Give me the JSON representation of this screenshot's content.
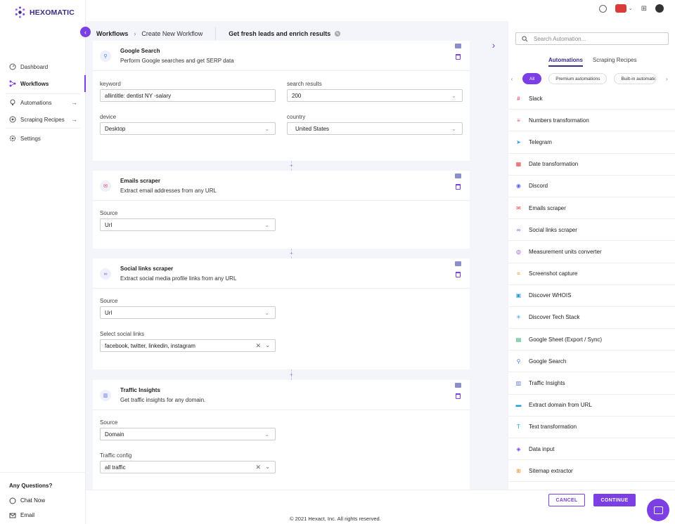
{
  "app": {
    "name": "HEXOMATIC"
  },
  "sidebar": {
    "items": [
      {
        "label": "Dashboard",
        "icon": "dashboard-icon"
      },
      {
        "label": "Workflows",
        "icon": "workflow-icon",
        "active": true
      },
      {
        "label": "Automations",
        "icon": "automation-icon",
        "arrow": "→"
      },
      {
        "label": "Scraping Recipes",
        "icon": "recipe-icon",
        "arrow": "→"
      },
      {
        "label": "Settings",
        "icon": "gear-icon"
      }
    ],
    "questions_title": "Any Questions?",
    "chat_label": "Chat Now",
    "email_label": "Email"
  },
  "breadcrumb": {
    "root": "Workflows",
    "current": "Create New Workflow"
  },
  "workflow_title": "Get fresh leads and enrich results",
  "cards": [
    {
      "title": "Google Search",
      "description": "Perform Google searches and get SERP data",
      "fields": [
        {
          "label": "keyword",
          "value": "allintitle: dentist NY -salary"
        },
        {
          "label": "search results",
          "value": "200"
        },
        {
          "label": "device",
          "value": "Desktop"
        },
        {
          "label": "country",
          "value": "United States"
        }
      ]
    },
    {
      "title": "Emails scraper",
      "description": "Extract email addresses from any URL",
      "fields": [
        {
          "label": "Source",
          "value": "Url"
        }
      ]
    },
    {
      "title": "Social links scraper",
      "description": "Extract social media profile links from any URL",
      "fields": [
        {
          "label": "Source",
          "value": "Url"
        },
        {
          "label": "Select social links",
          "value": "facebook, twitter, linkedin, instagram"
        }
      ]
    },
    {
      "title": "Traffic Insights",
      "description": "Get traffic insights for any domain.",
      "fields": [
        {
          "label": "Source",
          "value": "Domain"
        },
        {
          "label": "Traffic config",
          "value": "all traffic"
        }
      ]
    }
  ],
  "right_panel": {
    "search_placeholder": "Search Automation...",
    "tabs": [
      "Automations",
      "Scraping Recipes"
    ],
    "chips": [
      "All",
      "Premium automations",
      "Built-in automations"
    ],
    "automations": [
      {
        "label": "Slack",
        "color": "#e01e5a",
        "glyph": "#"
      },
      {
        "label": "Numbers transformation",
        "color": "#d94b6b",
        "glyph": "≡"
      },
      {
        "label": "Telegram",
        "color": "#2a9fd9",
        "glyph": "➤"
      },
      {
        "label": "Date transformation",
        "color": "#e0403f",
        "glyph": "▦"
      },
      {
        "label": "Discord",
        "color": "#5865f2",
        "glyph": "◉"
      },
      {
        "label": "Emails scraper",
        "color": "#e0403f",
        "glyph": "✉"
      },
      {
        "label": "Social links scraper",
        "color": "#5a6fd8",
        "glyph": "∞"
      },
      {
        "label": "Measurement units converter",
        "color": "#7b3fe4",
        "glyph": "◎"
      },
      {
        "label": "Screenshot capture",
        "color": "#f08a24",
        "glyph": "⌗"
      },
      {
        "label": "Discover WHOIS",
        "color": "#2a9fd9",
        "glyph": "▣"
      },
      {
        "label": "Discover Tech Stack",
        "color": "#2a9fd9",
        "glyph": "✳"
      },
      {
        "label": "Google Sheet (Export / Sync)",
        "color": "#1fa463",
        "glyph": "▤"
      },
      {
        "label": "Google Search",
        "color": "#4285f4",
        "glyph": "⚲"
      },
      {
        "label": "Traffic Insights",
        "color": "#5a6fd8",
        "glyph": "▥"
      },
      {
        "label": "Extract domain from URL",
        "color": "#1aa1d9",
        "glyph": "▬"
      },
      {
        "label": "Text transformation",
        "color": "#2a9fd9",
        "glyph": "T"
      },
      {
        "label": "Data input",
        "color": "#7b3fe4",
        "glyph": "◈"
      },
      {
        "label": "Sitemap extractor",
        "color": "#f08a24",
        "glyph": "⊞"
      }
    ]
  },
  "footer": {
    "cancel_label": "CANCEL",
    "continue_label": "CONTINUE",
    "copyright": "© 2021 Hexact, Inc. All rights reserved."
  },
  "colors": {
    "accent": "#7b3fe4",
    "brand": "#3b2a84"
  }
}
